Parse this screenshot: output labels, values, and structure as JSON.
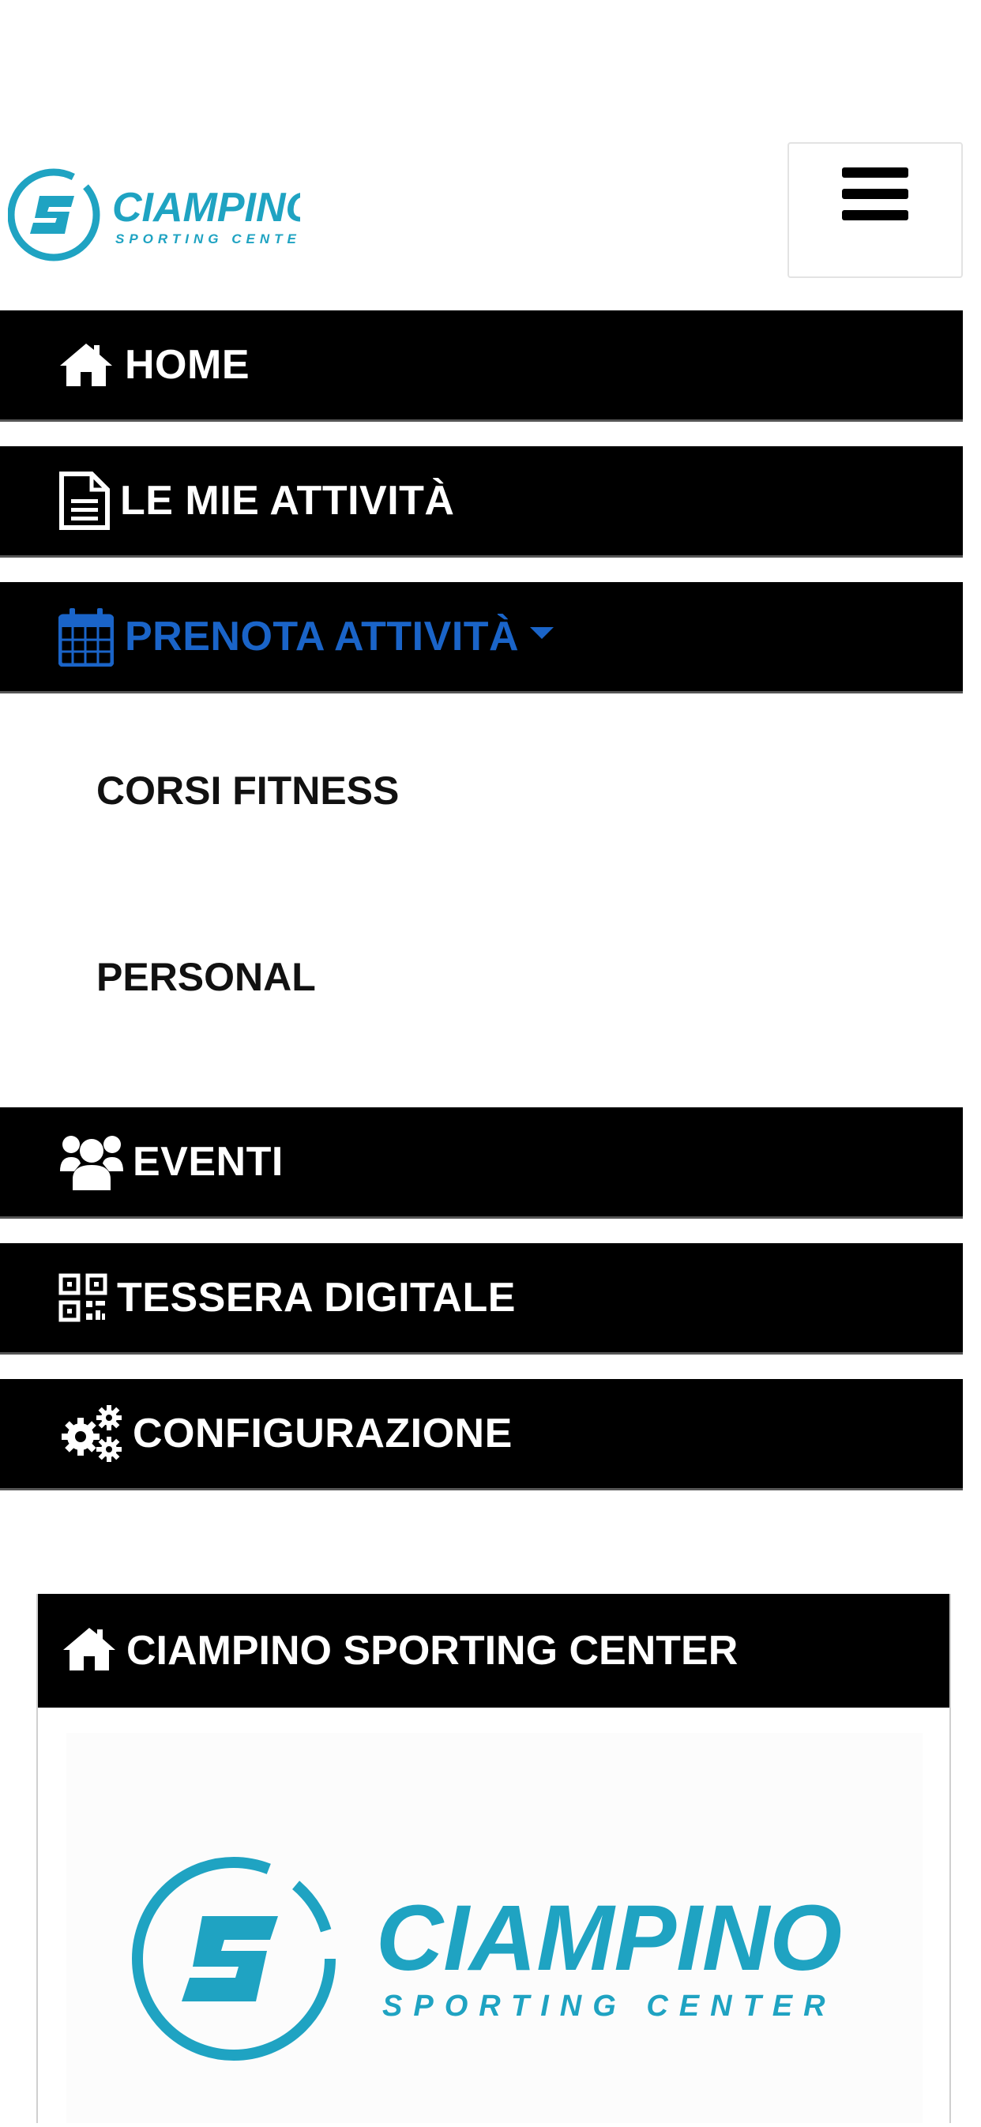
{
  "brand": {
    "name": "CIAMPINO",
    "tagline": "SPORTING CENTER",
    "color": "#1fa3c2"
  },
  "menu_toggle": {
    "icon": "hamburger-icon"
  },
  "nav": [
    {
      "label": "HOME",
      "icon": "home-icon"
    },
    {
      "label": "LE MIE ATTIVITÀ",
      "icon": "file-text-icon"
    },
    {
      "label": "PRENOTA ATTIVITÀ",
      "icon": "calendar-icon",
      "active": true,
      "expanded": true
    },
    {
      "label": "EVENTI",
      "icon": "users-icon"
    },
    {
      "label": "TESSERA DIGITALE",
      "icon": "qrcode-icon"
    },
    {
      "label": "CONFIGURAZIONE",
      "icon": "gears-icon"
    }
  ],
  "submenu": [
    {
      "label": "CORSI FITNESS"
    },
    {
      "label": "PERSONAL"
    }
  ],
  "card": {
    "title": "CIAMPINO SPORTING CENTER",
    "icon": "home-icon"
  },
  "colors": {
    "nav_background": "#000000",
    "active_text": "#1a64c8",
    "accent": "#1fa3c2"
  }
}
